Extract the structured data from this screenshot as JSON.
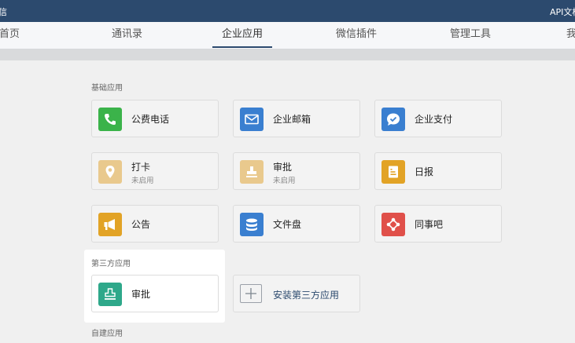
{
  "topbar": {
    "brand": "信",
    "right_text": "API文档"
  },
  "nav": {
    "items": [
      "首页",
      "通讯录",
      "企业应用",
      "微信插件",
      "管理工具",
      "我"
    ],
    "active": "企业应用"
  },
  "sections": {
    "basic": "基础应用",
    "third_party": "第三方应用",
    "custom": "自建应用"
  },
  "apps": {
    "phone": {
      "label": "公费电话",
      "icon": "phone-icon",
      "color": "#3bb34a"
    },
    "mail": {
      "label": "企业邮箱",
      "icon": "mail-icon",
      "color": "#3a7fd0"
    },
    "pay": {
      "label": "企业支付",
      "icon": "chat-check-icon",
      "color": "#3a7fd0"
    },
    "checkin": {
      "label": "打卡",
      "status": "未启用",
      "icon": "location-pin-icon",
      "color": "#e9c98d"
    },
    "approval": {
      "label": "审批",
      "status": "未启用",
      "icon": "stamp-icon",
      "color": "#e9c98d"
    },
    "daily": {
      "label": "日报",
      "icon": "report-icon",
      "color": "#e2a326"
    },
    "notice": {
      "label": "公告",
      "icon": "megaphone-icon",
      "color": "#e2a326"
    },
    "files": {
      "label": "文件盘",
      "icon": "database-icon",
      "color": "#3a7fd0"
    },
    "forum": {
      "label": "同事吧",
      "icon": "network-icon",
      "color": "#e0504a"
    },
    "approval3": {
      "label": "审批",
      "icon": "stamp-icon",
      "color": "#2ea88a"
    }
  },
  "install": {
    "label": "安装第三方应用",
    "icon": "plus-icon"
  }
}
